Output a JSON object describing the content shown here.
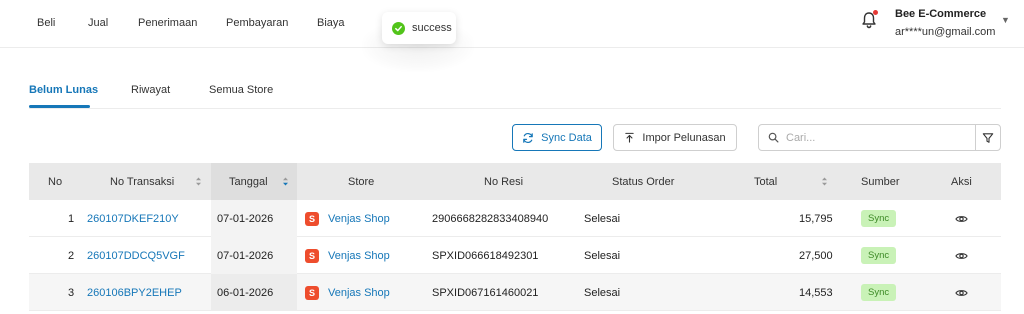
{
  "nav": {
    "items": [
      "Beli",
      "Jual",
      "Penerimaan",
      "Pembayaran",
      "Biaya"
    ]
  },
  "toast": {
    "text": "success",
    "icon": "check-circle-icon",
    "color": "#52c41a"
  },
  "account": {
    "name": "Bee E-Commerce",
    "email": "ar****un@gmail.com"
  },
  "tabs": [
    "Belum Lunas",
    "Riwayat",
    "Semua Store"
  ],
  "toolbar": {
    "sync_label": "Sync Data",
    "impor_label": "Impor Pelunasan",
    "search_placeholder": "Cari...",
    "search_value": ""
  },
  "table": {
    "headers": {
      "no": "No",
      "no_transaksi": "No Transaksi",
      "tanggal": "Tanggal",
      "store": "Store",
      "no_resi": "No Resi",
      "status_order": "Status Order",
      "total": "Total",
      "sumber": "Sumber",
      "aksi": "Aksi"
    },
    "rows": [
      {
        "no": "1",
        "no_transaksi": "260107DKEF210Y",
        "tanggal": "07-01-2026",
        "store": "Venjas Shop",
        "no_resi": "2906668282833408940",
        "status_order": "Selesai",
        "total": "15,795",
        "sumber": "Sync"
      },
      {
        "no": "2",
        "no_transaksi": "260107DDCQ5VGF",
        "tanggal": "07-01-2026",
        "store": "Venjas Shop",
        "no_resi": "SPXID066618492301",
        "status_order": "Selesai",
        "total": "27,500",
        "sumber": "Sync"
      },
      {
        "no": "3",
        "no_transaksi": "260106BPY2EHEP",
        "tanggal": "06-01-2026",
        "store": "Venjas Shop",
        "no_resi": "SPXID067161460021",
        "status_order": "Selesai",
        "total": "14,553",
        "sumber": "Sync"
      }
    ],
    "store_icon": {
      "name": "shopee-icon",
      "glyph": "S",
      "color": "#ee4d2d"
    }
  },
  "colors": {
    "accent": "#1677b8",
    "badge_bg": "#c9f2b7",
    "badge_text": "#3d8a26",
    "notification_dot": "#e53935"
  }
}
